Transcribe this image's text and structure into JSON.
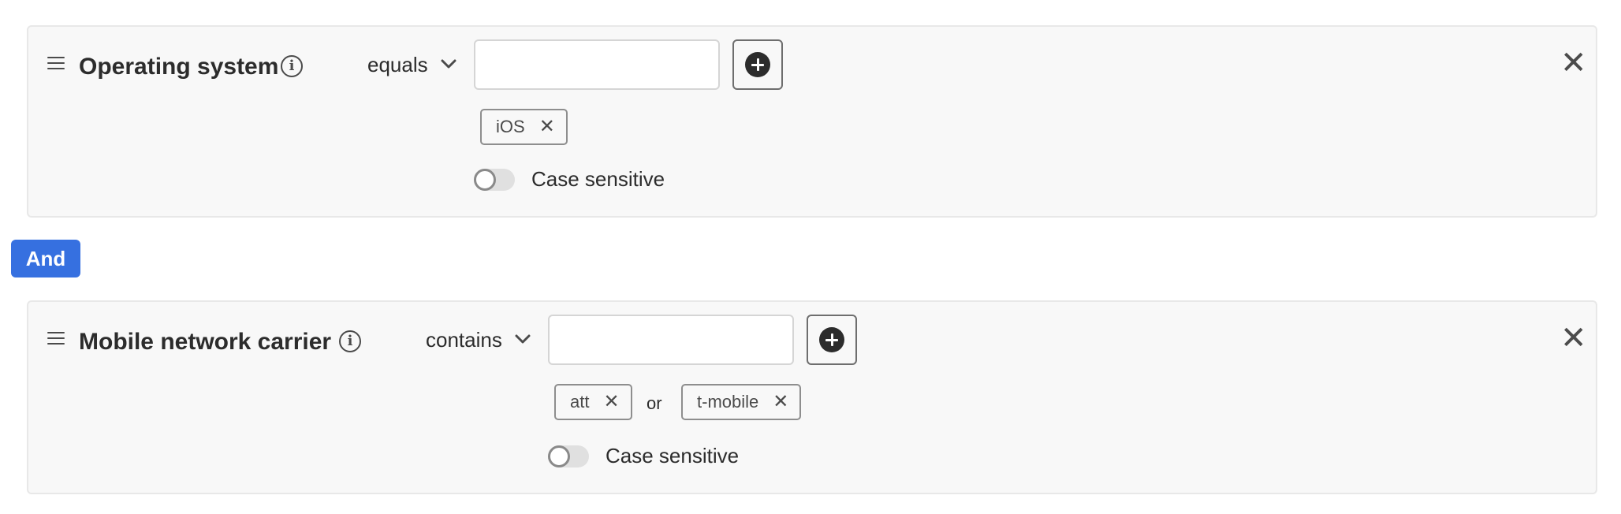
{
  "rules": [
    {
      "dimension": "Operating system",
      "operator": "equals",
      "input_value": "",
      "tags": [
        "iOS"
      ],
      "joiner": "",
      "case_sensitive_label": "Case sensitive",
      "case_sensitive_on": false
    },
    {
      "dimension": "Mobile network carrier",
      "operator": "contains",
      "input_value": "",
      "tags": [
        "att",
        "t-mobile"
      ],
      "joiner": "or",
      "case_sensitive_label": "Case sensitive",
      "case_sensitive_on": false
    }
  ],
  "connector": {
    "label": "And"
  },
  "icons": {
    "drag": "drag-handle-icon",
    "info": "info-icon",
    "add": "add-circle-icon",
    "remove_tag": "close-icon",
    "remove_rule": "close-icon",
    "dropdown": "chevron-down-icon"
  },
  "colors": {
    "accent": "#3670e0",
    "panel_bg": "#f8f8f8",
    "panel_border": "#e8e8e8",
    "text": "#2c2c2c"
  }
}
